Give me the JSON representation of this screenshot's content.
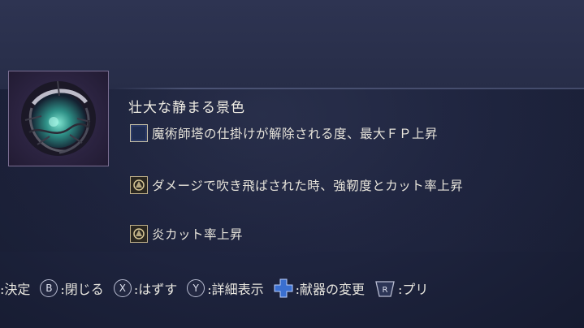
{
  "relic": {
    "title": "壮大な静まる景色",
    "effects": [
      {
        "icon": "blank-square-icon",
        "text": "魔術師塔の仕掛けが解除される度、最大ＦＰ上昇"
      },
      {
        "icon": "crest-icon",
        "text": "ダメージで吹き飛ばされた時、強靭度とカット率上昇"
      },
      {
        "icon": "crest-icon",
        "text": "炎カット率上昇"
      }
    ]
  },
  "controls": {
    "confirm": ":決定",
    "b_label": "B",
    "close": ":閉じる",
    "x_label": "X",
    "remove": ":はずす",
    "y_label": "Y",
    "details": ":詳細表示",
    "change_vessel": ":献器の変更",
    "preset": ":プリ"
  }
}
